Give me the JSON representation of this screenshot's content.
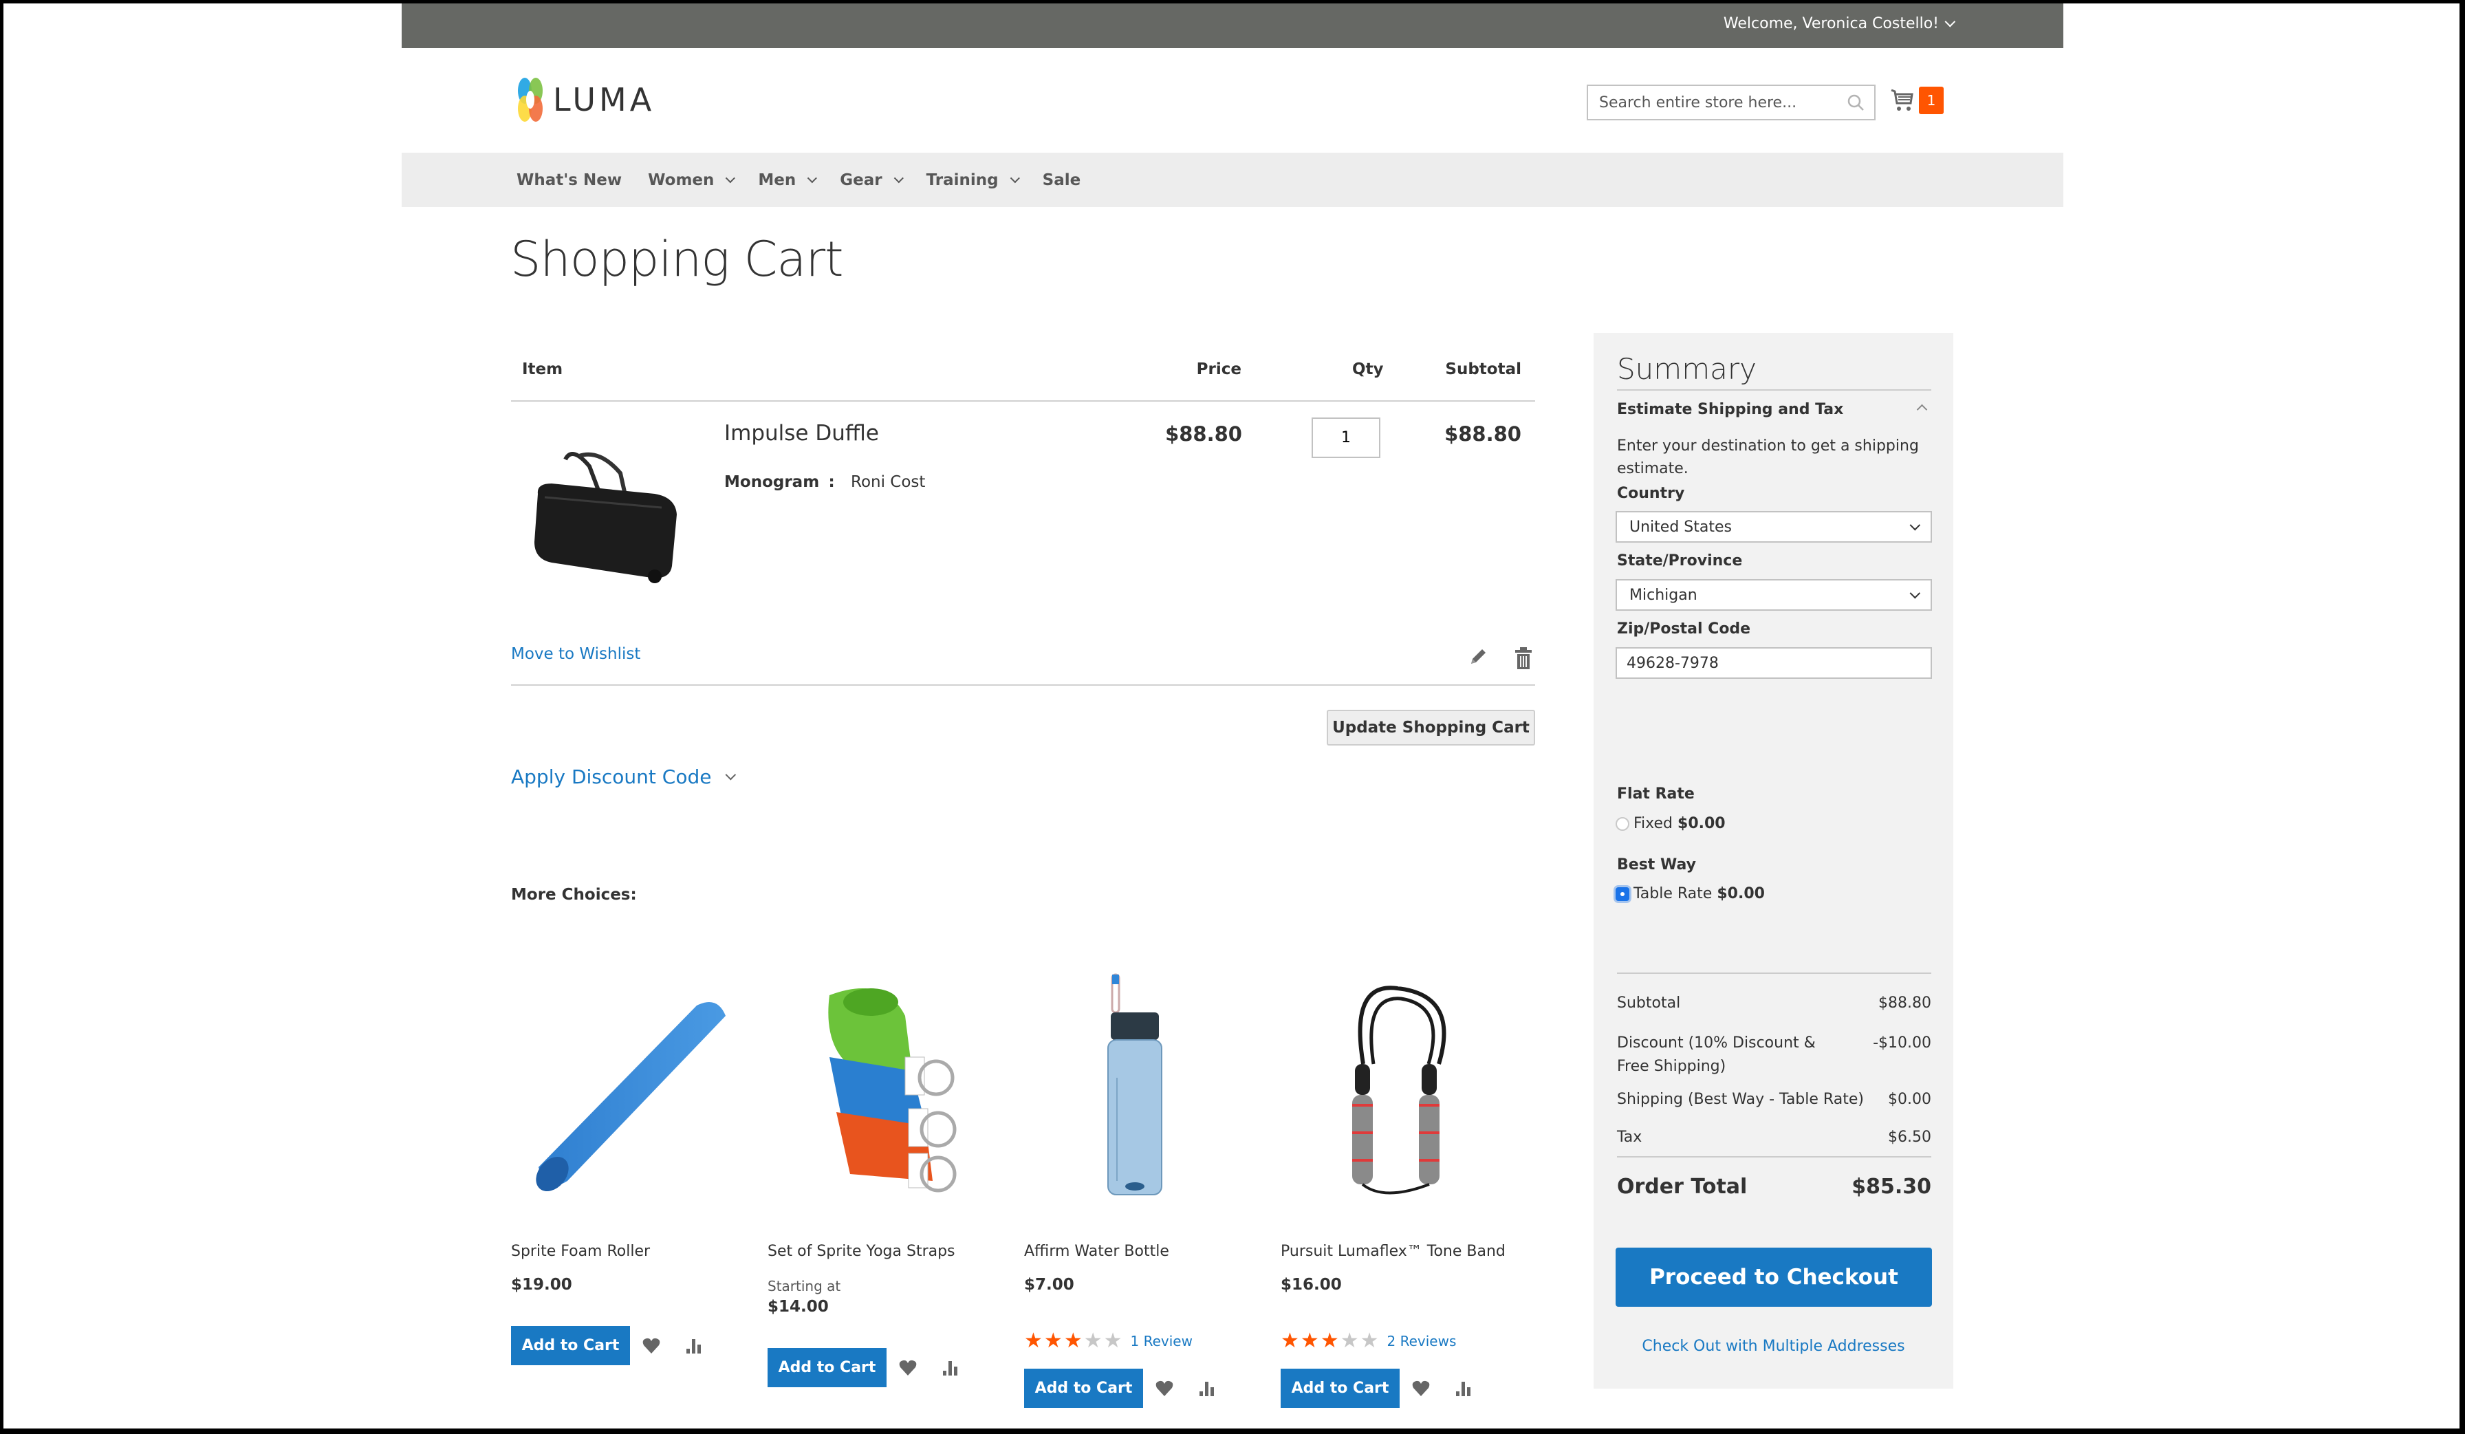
{
  "header": {
    "welcome": "Welcome, Veronica Costello!",
    "logo_text": "LUMA",
    "search_placeholder": "Search entire store here...",
    "cart_count": "1"
  },
  "nav": {
    "items": [
      {
        "label": "What's New",
        "has_dropdown": false
      },
      {
        "label": "Women",
        "has_dropdown": true
      },
      {
        "label": "Men",
        "has_dropdown": true
      },
      {
        "label": "Gear",
        "has_dropdown": true
      },
      {
        "label": "Training",
        "has_dropdown": true
      },
      {
        "label": "Sale",
        "has_dropdown": false
      }
    ]
  },
  "page": {
    "title": "Shopping Cart"
  },
  "cart": {
    "columns": {
      "item": "Item",
      "price": "Price",
      "qty": "Qty",
      "subtotal": "Subtotal"
    },
    "items": [
      {
        "name": "Impulse Duffle",
        "option_label": "Monogram",
        "option_separator": ":",
        "option_value": "Roni Cost",
        "price": "$88.80",
        "qty": "1",
        "subtotal": "$88.80",
        "move_to_wishlist": "Move to Wishlist"
      }
    ],
    "update_button": "Update Shopping Cart",
    "discount_toggle": "Apply Discount Code"
  },
  "more_choices": {
    "heading": "More Choices:",
    "products": [
      {
        "name": "Sprite Foam Roller",
        "price_prefix": "",
        "price": "$19.00",
        "rating": null,
        "reviews": "",
        "add_label": "Add to Cart"
      },
      {
        "name": "Set of Sprite Yoga Straps",
        "price_prefix": "Starting at",
        "price": "$14.00",
        "rating": null,
        "reviews": "",
        "add_label": "Add to Cart"
      },
      {
        "name": "Affirm Water Bottle",
        "price_prefix": "",
        "price": "$7.00",
        "rating": 3,
        "rating_max": 5,
        "reviews": "1 Review",
        "add_label": "Add to Cart"
      },
      {
        "name": "Pursuit Lumaflex™ Tone Band",
        "price_prefix": "",
        "price": "$16.00",
        "rating": 3,
        "rating_max": 5,
        "reviews": "2 Reviews",
        "add_label": "Add to Cart"
      }
    ]
  },
  "summary": {
    "title": "Summary",
    "estimate_heading": "Estimate Shipping and Tax",
    "estimate_desc": "Enter your destination to get a shipping estimate.",
    "country_label": "Country",
    "country_value": "United States",
    "state_label": "State/Province",
    "state_value": "Michigan",
    "zip_label": "Zip/Postal Code",
    "zip_value": "49628-7978",
    "carriers": [
      {
        "title": "Flat Rate",
        "method": "Fixed",
        "price": "$0.00",
        "selected": false
      },
      {
        "title": "Best Way",
        "method": "Table Rate",
        "price": "$0.00",
        "selected": true
      }
    ],
    "totals": [
      {
        "label": "Subtotal",
        "value": "$88.80"
      },
      {
        "label": "Discount (10% Discount & Free Shipping)",
        "value": "-$10.00"
      },
      {
        "label": "Shipping (Best Way - Table Rate)",
        "value": "$0.00"
      },
      {
        "label": "Tax",
        "value": "$6.50"
      }
    ],
    "order_total_label": "Order Total",
    "order_total_value": "$85.30",
    "checkout_button": "Proceed to Checkout",
    "multi_address_link": "Check Out with Multiple Addresses"
  },
  "colors": {
    "top_bar": "#666864",
    "nav_bg": "#ededed",
    "primary": "#1979c3",
    "badge": "#ff5501",
    "star": "#ff5501",
    "summary_bg": "#f2f2f2"
  }
}
